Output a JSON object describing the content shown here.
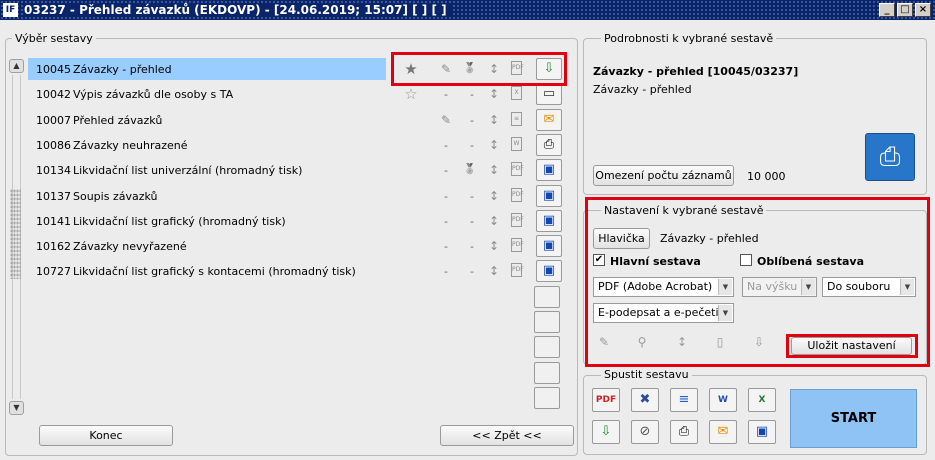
{
  "window": {
    "title": "03237 - Přehled závazků (EKDOVP) - [24.06.2019; 15:07]  [ ]  [ ]",
    "logo": "IF",
    "buttons": [
      "_",
      "□",
      "×"
    ]
  },
  "left": {
    "group_title": "Výběr sestavy",
    "rows": [
      {
        "code": "10045",
        "name": "Závazky - přehled",
        "selected": true,
        "star": "★",
        "edit": "✎",
        "medal": "🏅",
        "sort": "↕",
        "file": "PDF",
        "output": "⇩",
        "output_icon": "download-icon"
      },
      {
        "code": "10042",
        "name": "Výpis závazků dle osoby s TA",
        "star": "☆",
        "edit": "-",
        "medal": "-",
        "sort": "↕",
        "file": "X",
        "output": "▭",
        "output_icon": "archive-icon"
      },
      {
        "code": "10007",
        "name": "Přehled závazků",
        "star": "",
        "edit": "✎",
        "medal": "-",
        "sort": "↕",
        "file": "≡",
        "output": "✉",
        "output_icon": "email-icon"
      },
      {
        "code": "10086",
        "name": "Závazky neuhrazené",
        "star": "",
        "edit": "-",
        "medal": "-",
        "sort": "↕",
        "file": "W",
        "output": "⎙",
        "output_icon": "printer-icon"
      },
      {
        "code": "10134",
        "name": "Likvidační list univerzální (hromadný tisk)",
        "star": "",
        "edit": "-",
        "medal": "🏅",
        "sort": "↕",
        "file": "PDF",
        "output": "▣",
        "output_icon": "monitor-icon"
      },
      {
        "code": "10137",
        "name": "Soupis závazků",
        "star": "",
        "edit": "-",
        "medal": "-",
        "sort": "↕",
        "file": "PDF",
        "output": "▣",
        "output_icon": "monitor-icon"
      },
      {
        "code": "10141",
        "name": "Likvidační list grafický (hromadný tisk)",
        "star": "",
        "edit": "-",
        "medal": "-",
        "sort": "↕",
        "file": "PDF",
        "output": "▣",
        "output_icon": "monitor-icon"
      },
      {
        "code": "10162",
        "name": "Závazky nevyřazené",
        "star": "",
        "edit": "-",
        "medal": "-",
        "sort": "↕",
        "file": "PDF",
        "output": "▣",
        "output_icon": "monitor-icon"
      },
      {
        "code": "10727",
        "name": "Likvidační list grafický s kontacemi (hromadný tisk)",
        "star": "",
        "edit": "-",
        "medal": "-",
        "sort": "↕",
        "file": "PDF",
        "output": "▣",
        "output_icon": "monitor-icon"
      }
    ],
    "konec": "Konec",
    "zpet": "<< Zpět <<"
  },
  "detail": {
    "group_title": "Podrobnosti k vybrané sestavě",
    "title": "Závazky - přehled [10045/03237]",
    "subtitle": "Závazky - přehled",
    "limit_button": "Omezení počtu záznamů",
    "limit_value": "10 000",
    "printer_icon": "printer-help-icon"
  },
  "settings": {
    "group_title": "Nastavení k vybrané sestavě",
    "header_button": "Hlavička",
    "header_value": "Závazky - přehled",
    "main_label": "Hlavní sestava",
    "main_checked": true,
    "fav_label": "Oblíbená sestava",
    "fav_checked": false,
    "format": "PDF (Adobe Acrobat)",
    "orientation": "Na výšku",
    "destination": "Do souboru",
    "sign": "E-podepsat a e-pečetit",
    "save_button": "Uložit nastavení"
  },
  "run": {
    "group_title": "Spustit sestavu",
    "start": "START",
    "buttons": [
      {
        "icon": "pdf-icon",
        "glyph": "PDF",
        "color": "#d32020"
      },
      {
        "icon": "xml-icon",
        "glyph": "✖",
        "color": "#2a4e9a"
      },
      {
        "icon": "text-icon",
        "glyph": "≡",
        "color": "#1f5fbf"
      },
      {
        "icon": "word-icon",
        "glyph": "W",
        "color": "#1f4fb0"
      },
      {
        "icon": "excel-icon",
        "glyph": "X",
        "color": "#1d7a2e"
      },
      {
        "icon": "download-icon",
        "glyph": "⇩",
        "color": "#1d8a2e"
      },
      {
        "icon": "attachment-icon",
        "glyph": "⊘",
        "color": "#555"
      },
      {
        "icon": "printer-icon",
        "glyph": "⎙",
        "color": "#000"
      },
      {
        "icon": "email-icon",
        "glyph": "✉",
        "color": "#e88a00"
      },
      {
        "icon": "monitor-icon",
        "glyph": "▣",
        "color": "#1546b0"
      }
    ]
  }
}
